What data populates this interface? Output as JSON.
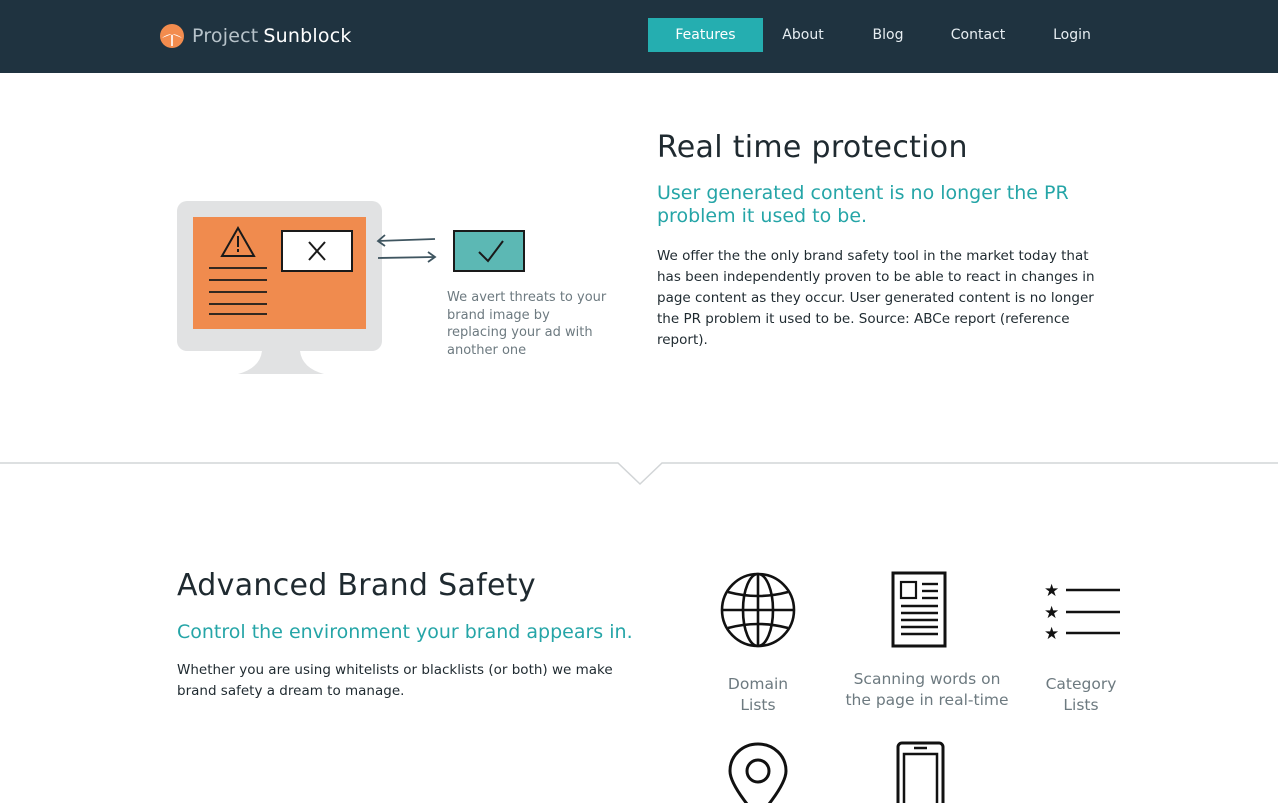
{
  "brand": {
    "name_part1": "Project",
    "name_part2": "Sunblock",
    "logo_icon": "sun-umbrella-logo-icon",
    "accent_color": "#f28c4e"
  },
  "nav": {
    "items": [
      {
        "label": "Features",
        "active": true
      },
      {
        "label": "About"
      },
      {
        "label": "Blog"
      },
      {
        "label": "Contact"
      },
      {
        "label": "Login"
      }
    ],
    "active_color": "#25aeb0",
    "bg_color": "#1f3340"
  },
  "section1": {
    "title": "Real time protection",
    "subtitle": "User generated content is no longer the PR problem it used to be.",
    "body": "We offer the the only brand safety tool in the market today that has been independently proven to be able to react in changes in page content as they occur. User generated content is no longer the PR problem it used to be. Source: ABCe report (reference report).",
    "illustration_caption": "We avert threats to your brand image by replacing your ad with another one"
  },
  "section2": {
    "title": "Advanced Brand Safety",
    "subtitle": "Control the environment your brand appears in.",
    "body": "Whether you are using whitelists or blacklists (or both) we make brand safety a dream to manage.",
    "features": [
      {
        "icon": "globe-icon",
        "label_line1": "Domain",
        "label_line2": "Lists"
      },
      {
        "icon": "document-icon",
        "label_line1": "Scanning words on",
        "label_line2": "the page in real-time"
      },
      {
        "icon": "starred-list-icon",
        "label_line1": "Category",
        "label_line2": "Lists"
      },
      {
        "icon": "location-pin-icon"
      },
      {
        "icon": "mobile-phone-icon"
      }
    ]
  }
}
